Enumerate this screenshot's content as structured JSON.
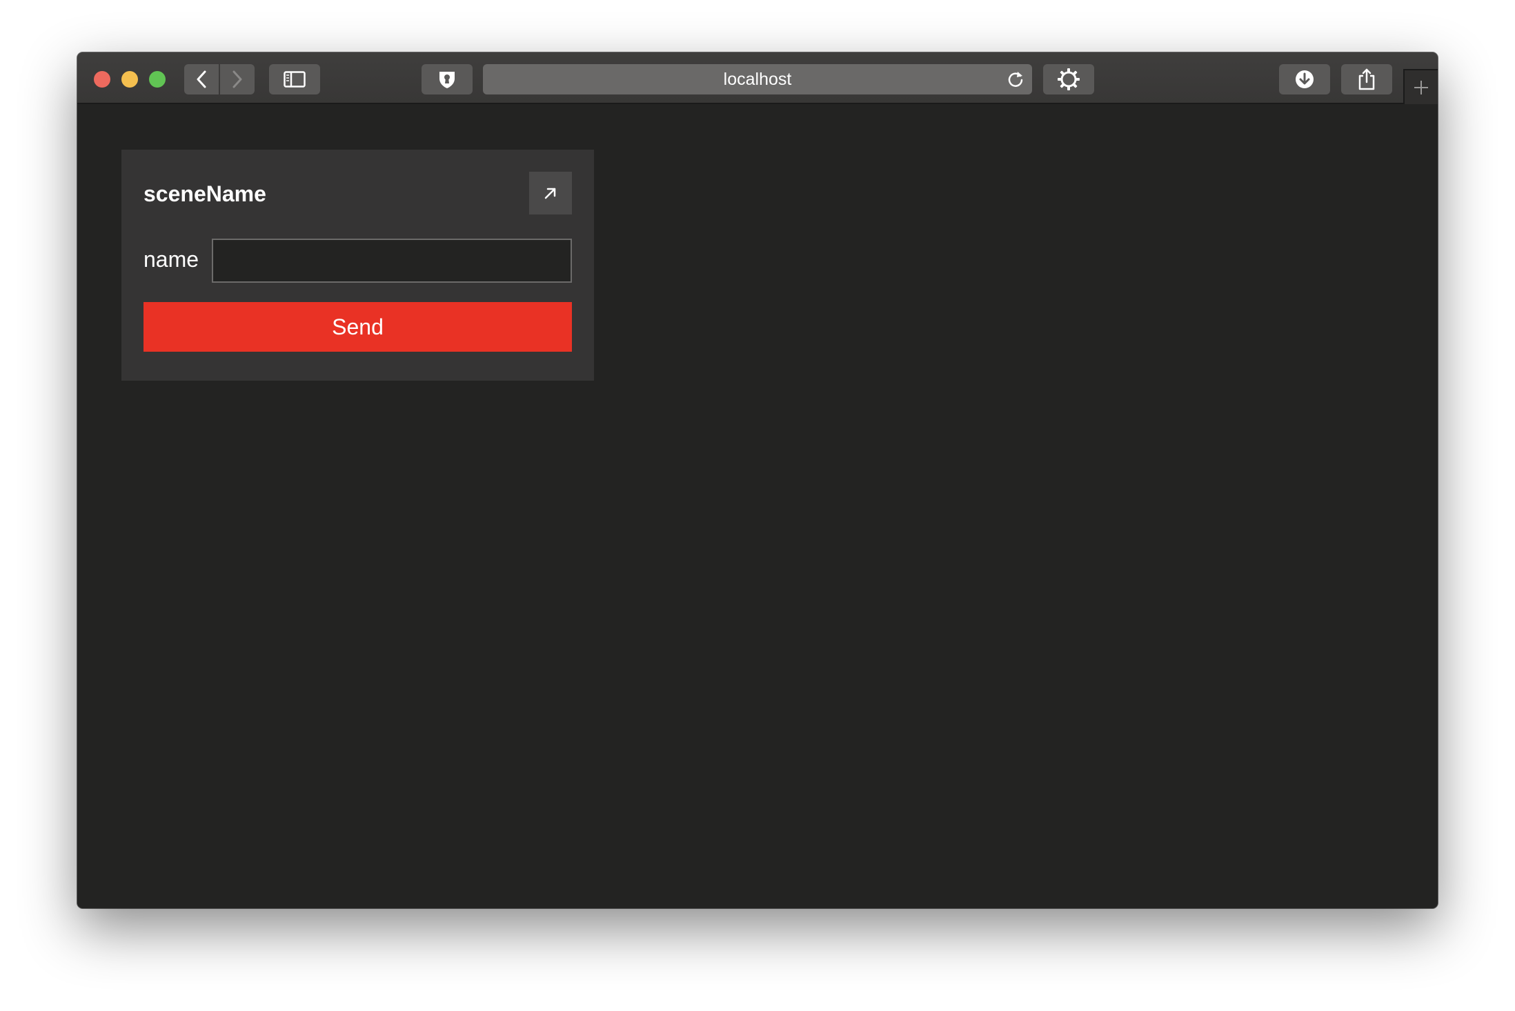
{
  "browser": {
    "address": "localhost",
    "icons": {
      "back": "chevron-left-icon",
      "forward": "chevron-right-icon",
      "sidebar": "sidebar-icon",
      "privacy": "shield-keyhole-icon",
      "reload": "reload-icon",
      "extension": "gear-icon",
      "download": "download-icon",
      "share": "share-icon",
      "new_tab": "plus-icon"
    }
  },
  "panel": {
    "title": "sceneName",
    "field_label": "name",
    "field_value": "",
    "field_placeholder": "",
    "send_label": "Send",
    "expand_icon": "arrow-up-right-icon"
  },
  "colors": {
    "accent": "#e93225",
    "background": "#232322",
    "panel": "#353434"
  }
}
